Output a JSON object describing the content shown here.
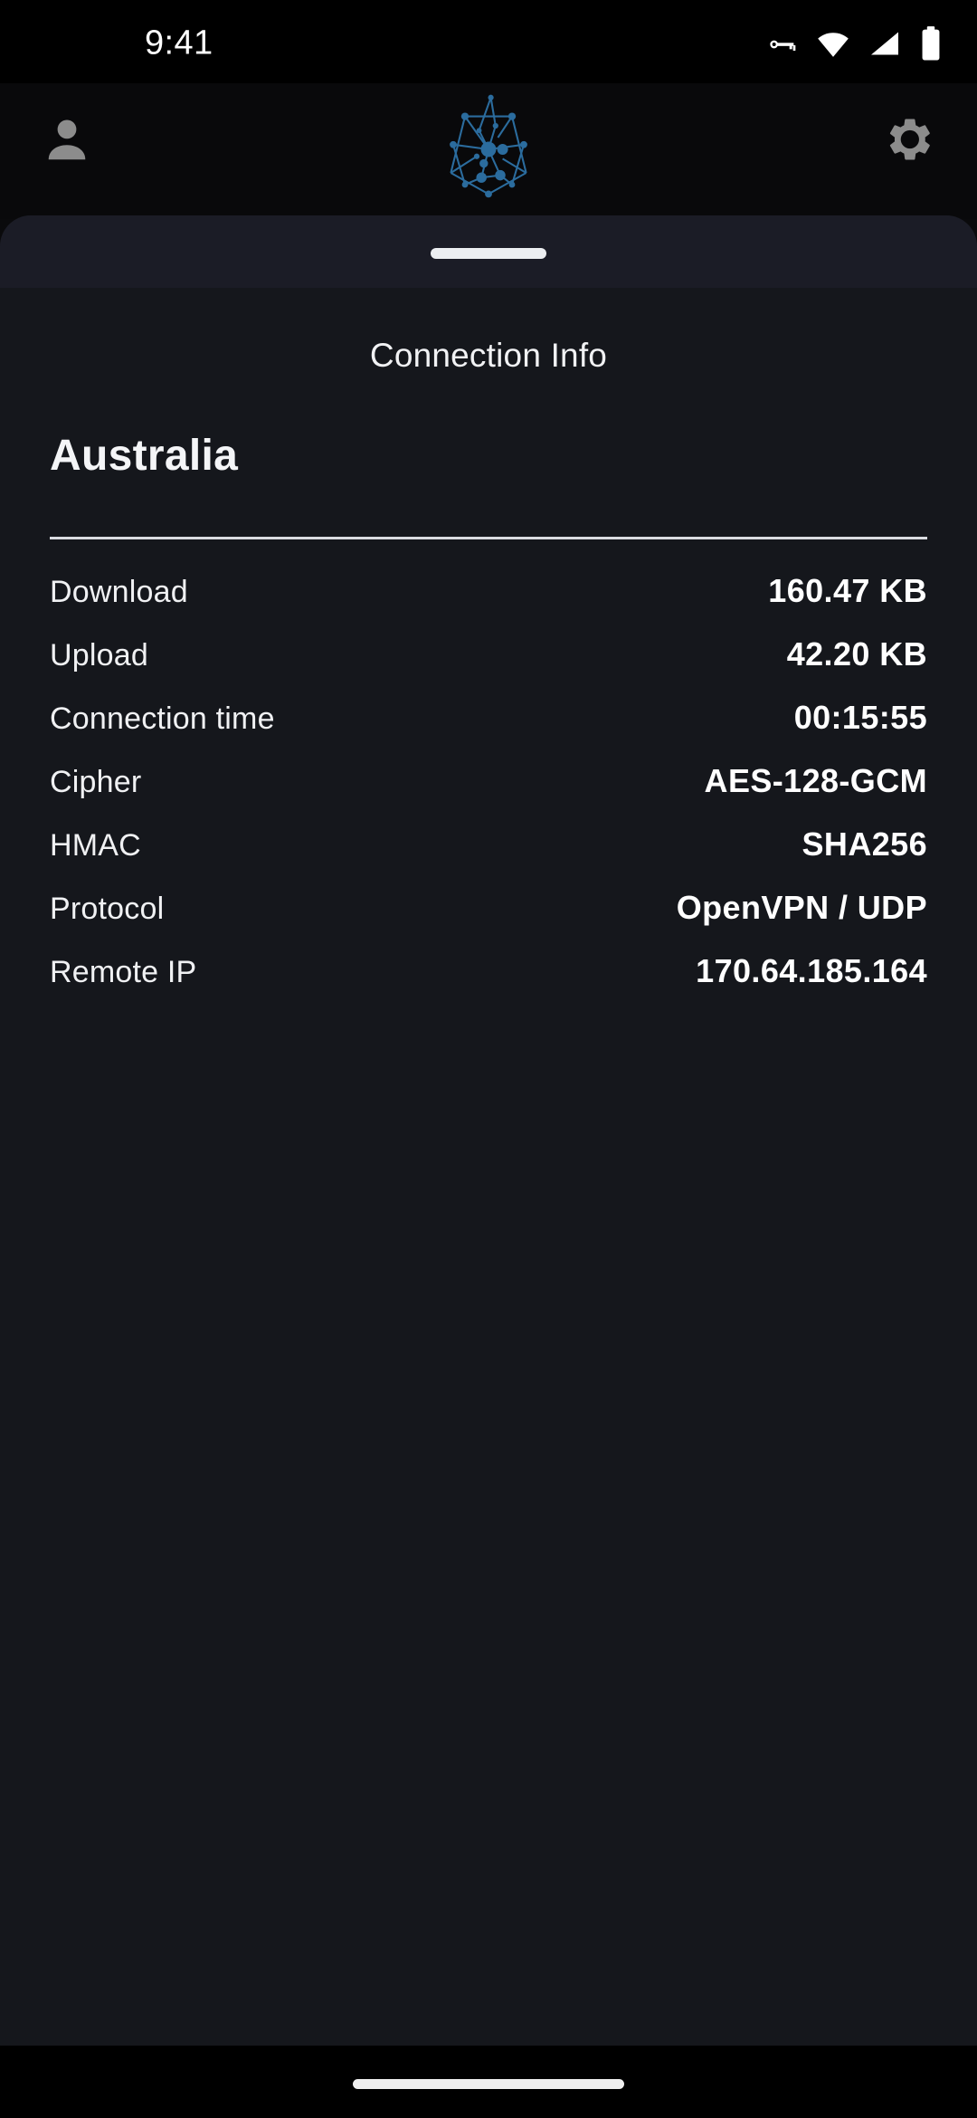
{
  "status_bar": {
    "time": "9:41",
    "icons": [
      {
        "name": "vpn-key-icon"
      },
      {
        "name": "wifi-icon"
      },
      {
        "name": "cellular-signal-icon"
      },
      {
        "name": "battery-icon"
      }
    ]
  },
  "app_header": {
    "profile_icon": "person-icon",
    "logo_icon": "network-nodes-logo-icon",
    "settings_icon": "gear-icon",
    "logo_color": "#2b6c9e"
  },
  "sheet": {
    "grabber": "drag-handle",
    "title": "Connection Info",
    "country": "Australia",
    "rows": [
      {
        "label": "Download",
        "value": "160.47 KB"
      },
      {
        "label": "Upload",
        "value": "42.20 KB"
      },
      {
        "label": "Connection time",
        "value": "00:15:55"
      },
      {
        "label": "Cipher",
        "value": "AES-128-GCM"
      },
      {
        "label": "HMAC",
        "value": "SHA256"
      },
      {
        "label": "Protocol",
        "value": "OpenVPN / UDP"
      },
      {
        "label": "Remote IP",
        "value": "170.64.185.164"
      }
    ]
  },
  "nav_bar": {
    "gesture_pill": "home-gesture-pill"
  },
  "colors": {
    "screen_background": "#0a0a0c",
    "sheet_background": "#15171c",
    "sheet_header_background": "#1b1c26",
    "divider": "#d9dbe0",
    "text_primary": "#ffffff",
    "accent": "#2b6c9e"
  }
}
